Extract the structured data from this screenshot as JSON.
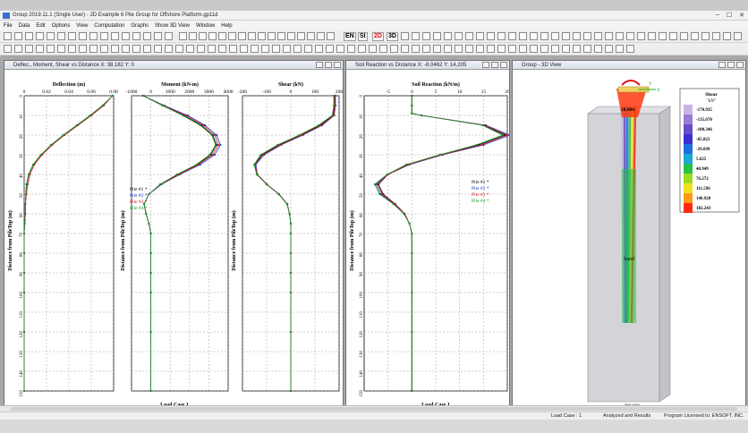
{
  "app": {
    "title": "Group 2019.11.1 (Single User) - 2D Example 6 Pile Group for Offshore Platform.gp11d"
  },
  "menu": [
    "File",
    "Data",
    "Edit",
    "Options",
    "View",
    "Computation",
    "Graphs",
    "Show 3D View",
    "Window",
    "Help"
  ],
  "toolbar": {
    "units_en": "EN",
    "units_si": "SI",
    "mode_2d": "2D",
    "mode_3d": "3D"
  },
  "windows": {
    "profiles": {
      "title": "Deflec., Moment, Shear vs Distance X: 38.182 Y: 0"
    },
    "soil": {
      "title": "Soil Reaction vs Distance X: -8.0462 Y: 14.205"
    },
    "view3d": {
      "title": "Group - 3D View"
    }
  },
  "ylabel": "Distance from PileTop (m)",
  "yticks": [
    "0",
    "10",
    "20",
    "30",
    "40",
    "50",
    "60",
    "70",
    "80",
    "90",
    "100",
    "110",
    "120",
    "130",
    "140",
    "150"
  ],
  "load_case": "Load Case 1",
  "legend": [
    "Pile #1",
    "Pile #2",
    "Pile #3",
    "Pile #4"
  ],
  "pile_colors": [
    "#000000",
    "#1f37c8",
    "#d11a1a",
    "#159a2e"
  ],
  "chart_data": [
    {
      "type": "line",
      "title": "Deflection (m)",
      "xlabel": "Deflection (m)",
      "ylabel": "Distance from PileTop (m)",
      "xlim": [
        0,
        0.08
      ],
      "ylim": [
        150,
        0
      ],
      "xticks": [
        "0",
        "0.02",
        "0.04",
        "0.06",
        "0.08"
      ],
      "x": [
        0,
        5,
        10,
        15,
        20,
        25,
        30,
        35,
        40,
        45,
        50,
        55,
        60,
        65,
        70,
        80,
        90,
        100,
        120,
        150
      ],
      "series": [
        {
          "name": "Pile #1",
          "values": [
            0.079,
            0.07,
            0.059,
            0.047,
            0.035,
            0.024,
            0.015,
            0.008,
            0.004,
            0.002,
            0.0015,
            0.001,
            0.001,
            0.0005,
            0,
            0,
            0,
            0,
            0,
            0
          ]
        },
        {
          "name": "Pile #2",
          "values": [
            0.079,
            0.071,
            0.06,
            0.048,
            0.036,
            0.025,
            0.016,
            0.009,
            0.005,
            0.003,
            0.002,
            0.001,
            0.001,
            0.0005,
            0,
            0,
            0,
            0,
            0,
            0
          ]
        },
        {
          "name": "Pile #3",
          "values": [
            0.079,
            0.071,
            0.06,
            0.048,
            0.036,
            0.025,
            0.016,
            0.009,
            0.005,
            0.003,
            0.002,
            0.001,
            0.001,
            0.0005,
            0,
            0,
            0,
            0,
            0,
            0
          ]
        },
        {
          "name": "Pile #4",
          "values": [
            0.079,
            0.07,
            0.059,
            0.047,
            0.035,
            0.024,
            0.015,
            0.008,
            0.004,
            0.002,
            0.0015,
            0.001,
            0.001,
            0.0005,
            0,
            0,
            0,
            0,
            0,
            0
          ]
        }
      ]
    },
    {
      "type": "line",
      "title": "Moment (kN-m)",
      "xlabel": "Moment (kN-m)",
      "ylabel": "Distance from PileTop (m)",
      "xlim": [
        -1000,
        4000
      ],
      "ylim": [
        150,
        0
      ],
      "xticks": [
        "-1000",
        "0",
        "1000",
        "2000",
        "3000",
        "4000"
      ],
      "x": [
        0,
        5,
        10,
        15,
        20,
        25,
        30,
        35,
        40,
        45,
        50,
        55,
        60,
        65,
        70,
        80,
        90,
        100,
        120,
        150
      ],
      "series": [
        {
          "name": "Pile #1",
          "values": [
            -400,
            600,
            1700,
            2600,
            3200,
            3400,
            3100,
            2400,
            1400,
            500,
            -100,
            -350,
            -250,
            -100,
            0,
            0,
            0,
            0,
            0,
            0
          ]
        },
        {
          "name": "Pile #2",
          "values": [
            -400,
            700,
            1900,
            2800,
            3400,
            3600,
            3300,
            2550,
            1500,
            550,
            -100,
            -350,
            -250,
            -100,
            0,
            0,
            0,
            0,
            0,
            0
          ]
        },
        {
          "name": "Pile #3",
          "values": [
            -400,
            650,
            1800,
            2700,
            3300,
            3500,
            3200,
            2450,
            1450,
            520,
            -100,
            -350,
            -250,
            -100,
            0,
            0,
            0,
            0,
            0,
            0
          ]
        },
        {
          "name": "Pile #4",
          "values": [
            -400,
            600,
            1650,
            2550,
            3150,
            3350,
            3050,
            2350,
            1350,
            480,
            -100,
            -350,
            -250,
            -100,
            0,
            0,
            0,
            0,
            0,
            0
          ]
        }
      ]
    },
    {
      "type": "line",
      "title": "Shear (kN)",
      "xlabel": "Shear (kN)",
      "ylabel": "Distance from PileTop (m)",
      "xlim": [
        -200,
        200
      ],
      "ylim": [
        150,
        0
      ],
      "xticks": [
        "-200",
        "-100",
        "0",
        "100",
        "200"
      ],
      "x": [
        0,
        5,
        10,
        15,
        20,
        25,
        30,
        35,
        40,
        45,
        50,
        55,
        60,
        65,
        70,
        80,
        90,
        100,
        120,
        150
      ],
      "series": [
        {
          "name": "Pile #1",
          "values": [
            180,
            180,
            175,
            120,
            40,
            -50,
            -120,
            -150,
            -140,
            -100,
            -50,
            -15,
            -5,
            0,
            0,
            0,
            0,
            0,
            0,
            0
          ]
        },
        {
          "name": "Pile #2",
          "values": [
            185,
            185,
            180,
            130,
            50,
            -40,
            -110,
            -145,
            -138,
            -98,
            -48,
            -14,
            -5,
            0,
            0,
            0,
            0,
            0,
            0,
            0
          ]
        },
        {
          "name": "Pile #3",
          "values": [
            182,
            182,
            178,
            125,
            45,
            -45,
            -115,
            -148,
            -139,
            -99,
            -49,
            -15,
            -5,
            0,
            0,
            0,
            0,
            0,
            0,
            0
          ]
        },
        {
          "name": "Pile #4",
          "values": [
            178,
            178,
            172,
            115,
            35,
            -55,
            -125,
            -152,
            -141,
            -101,
            -51,
            -16,
            -5,
            0,
            0,
            0,
            0,
            0,
            0,
            0
          ]
        }
      ]
    },
    {
      "type": "line",
      "title": "Soil Reaction (kN/m)",
      "xlabel": "Soil Reaction (kN/m)",
      "ylabel": "Distance from PileTop (m)",
      "xlim": [
        -10,
        20
      ],
      "ylim": [
        150,
        0
      ],
      "xticks": [
        "-5",
        "0",
        "5",
        "10",
        "15",
        "20"
      ],
      "x": [
        0,
        5,
        9,
        10,
        15,
        20,
        25,
        30,
        35,
        40,
        45,
        50,
        55,
        60,
        65,
        70,
        80,
        100,
        120,
        150
      ],
      "series": [
        {
          "name": "Pile #1",
          "values": [
            0,
            0,
            0,
            2,
            15,
            19.5,
            14,
            6,
            -1,
            -5,
            -7,
            -6,
            -3.5,
            -1.5,
            -0.5,
            0,
            0,
            0,
            0,
            0
          ]
        },
        {
          "name": "Pile #2",
          "values": [
            0,
            0,
            0,
            2,
            15.5,
            20.5,
            15,
            6.5,
            -0.5,
            -5,
            -7.5,
            -6.5,
            -3.8,
            -1.6,
            -0.5,
            0,
            0,
            0,
            0,
            0
          ]
        },
        {
          "name": "Pile #3",
          "values": [
            0,
            0,
            0,
            2,
            15.2,
            20,
            14.5,
            6.2,
            -0.8,
            -5,
            -7.2,
            -6.2,
            -3.6,
            -1.5,
            -0.5,
            0,
            0,
            0,
            0,
            0
          ]
        },
        {
          "name": "Pile #4",
          "values": [
            0,
            0,
            0,
            2,
            14.8,
            19,
            13.5,
            5.8,
            -1.2,
            -5.2,
            -7.8,
            -6.8,
            -3.9,
            -1.7,
            -0.5,
            0,
            0,
            0,
            0,
            0
          ]
        }
      ]
    }
  ],
  "view3d": {
    "legend_title": "Shear",
    "legend_unit": "kN",
    "legend_values": [
      "-170.935",
      "-135.670",
      "-100.346",
      "-65.022",
      "-29.699",
      "5.625",
      "40.949",
      "76.272",
      "111.596",
      "146.920",
      "182.243"
    ],
    "legend_colors": [
      "#c8b4e6",
      "#9a7cd4",
      "#6b4cc8",
      "#3a2fd0",
      "#1e6ee0",
      "#1aa8d8",
      "#27c24a",
      "#9bdc1e",
      "#f0e020",
      "#ff9a1a",
      "#ff2a10"
    ],
    "top_label": "10.000",
    "soil_label": "Sand",
    "bottom_label": "200.000",
    "axis_y": "Y",
    "axis_x": "X"
  },
  "status": {
    "load_case": "Load Case : 1",
    "analyzed": "Analyzed and Results",
    "license": "Program Licensed to: ENSOFT, INC."
  }
}
